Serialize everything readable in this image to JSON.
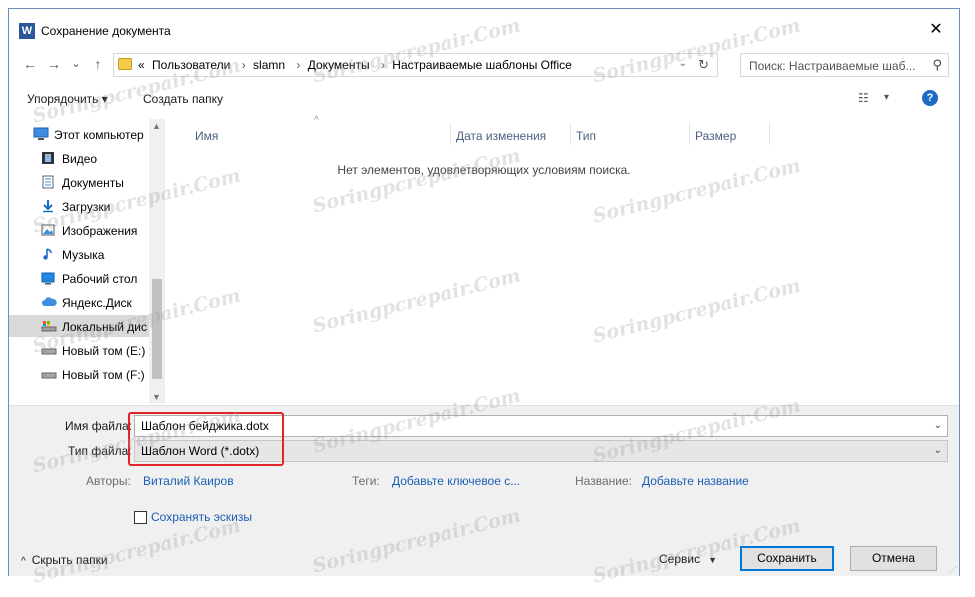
{
  "window": {
    "title": "Сохранение документа",
    "app_icon_letter": "W",
    "close_glyph": "✕"
  },
  "nav": {
    "back_glyph": "←",
    "forward_glyph": "→",
    "recent_glyph": "⌄",
    "up_glyph": "↑",
    "breadcrumb_prefix": "«",
    "breadcrumbs": [
      "Пользователи",
      "slamn",
      "Документы",
      "Настраиваемые шаблоны Office"
    ],
    "crumb_separator": "›",
    "dropdown_glyph": "⌄",
    "refresh_glyph": "↻",
    "search_placeholder": "Поиск: Настраиваемые шаб...",
    "search_glyph": "⚲"
  },
  "toolbar": {
    "organize_label": "Упорядочить ▾",
    "new_folder_label": "Создать папку",
    "view_glyph": "☷",
    "view_drop_glyph": "▾",
    "help_glyph": "?"
  },
  "sidebar": {
    "items": [
      {
        "label": "Этот компьютер",
        "icon": "computer-icon"
      },
      {
        "label": "Видео",
        "icon": "video-icon"
      },
      {
        "label": "Документы",
        "icon": "documents-icon"
      },
      {
        "label": "Загрузки",
        "icon": "downloads-icon"
      },
      {
        "label": "Изображения",
        "icon": "pictures-icon"
      },
      {
        "label": "Музыка",
        "icon": "music-icon"
      },
      {
        "label": "Рабочий стол",
        "icon": "desktop-icon"
      },
      {
        "label": "Яндекс.Диск",
        "icon": "cloud-icon"
      },
      {
        "label": "Локальный дис",
        "icon": "local-disk-icon"
      },
      {
        "label": "Новый том (E:)",
        "icon": "drive-icon"
      },
      {
        "label": "Новый том (F:)",
        "icon": "drive-icon"
      }
    ],
    "scroll_up_glyph": "▲",
    "scroll_down_glyph": "▼"
  },
  "content": {
    "columns": [
      "Имя",
      "Дата изменения",
      "Тип",
      "Размер"
    ],
    "sort_glyph": "^",
    "empty_message": "Нет элементов, удовлетворяющих условиям поиска."
  },
  "save": {
    "filename_label": "Имя файла:",
    "filename_value": "Шаблон бейджика.dotx",
    "filetype_label": "Тип файла:",
    "filetype_value": "Шаблон Word (*.dotx)",
    "dropdown_glyph": "⌄",
    "authors_label": "Авторы:",
    "authors_value": "Виталий Каиров",
    "tags_label": "Теги:",
    "tags_value": "Добавьте ключевое с...",
    "title_label": "Название:",
    "title_value": "Добавьте название",
    "thumbnails_label": "Сохранять эскизы",
    "hide_folders_label": "Скрыть папки",
    "hide_folders_glyph": "^",
    "service_label": "Сервис",
    "service_drop_glyph": "▼",
    "save_button": "Сохранить",
    "cancel_button": "Отмена",
    "resize_glyph": "⋰"
  },
  "colors": {
    "accent": "#0078d7",
    "link": "#1a5fb4",
    "highlight_frame": "#e0242a"
  },
  "watermark": "Soringpcrepair.Com"
}
